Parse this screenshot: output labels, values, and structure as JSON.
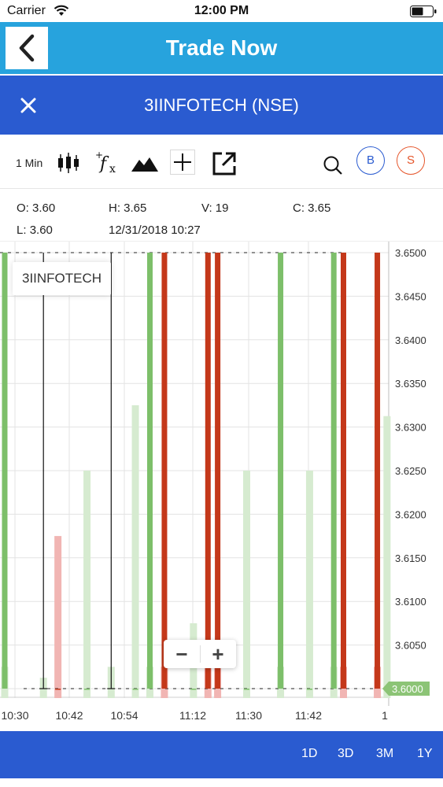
{
  "status_bar": {
    "carrier": "Carrier",
    "time": "12:00 PM"
  },
  "header": {
    "title": "Trade Now"
  },
  "symbol_bar": {
    "title": "3IINFOTECH (NSE)"
  },
  "toolbar": {
    "interval": "1 Min",
    "buy_label": "B",
    "sell_label": "S"
  },
  "ohlc": {
    "open_label": "O:",
    "open": "3.60",
    "high_label": "H:",
    "high": "3.65",
    "volume_label": "V:",
    "volume": "19",
    "close_label": "C:",
    "close": "3.65",
    "low_label": "L:",
    "low": "3.60",
    "datetime": "12/31/2018 10:27"
  },
  "chart": {
    "legend": "3IINFOTECH",
    "current_price": "3.6000"
  },
  "zoom": {
    "minus": "−",
    "plus": "+"
  },
  "range_tabs": [
    "1D",
    "3D",
    "3M",
    "1Y"
  ],
  "colors": {
    "up": "#7dbf6a",
    "down": "#c4381a",
    "up_volume": "#d6ebd0",
    "down_volume": "#f1b5b3",
    "grid": "#e3e3e3",
    "axis_text": "#333333",
    "price_badge": "#8cc476"
  },
  "chart_data": {
    "type": "candlestick",
    "title": "",
    "y_ticks": [
      "3.6500",
      "3.6450",
      "3.6400",
      "3.6350",
      "3.6300",
      "3.6250",
      "3.6200",
      "3.6150",
      "3.6100",
      "3.6050",
      "3.6000"
    ],
    "ylim": [
      3.6,
      3.65
    ],
    "x_ticks": [
      "10:30",
      "10:42",
      "10:54",
      "11:12",
      "11:30",
      "11:42",
      "1"
    ],
    "bars": [
      {
        "idx": 0,
        "dir": "up",
        "open": 3.6,
        "close": 3.65,
        "vol": 0.01
      },
      {
        "idx": 8,
        "dir": "flat",
        "open": 3.6,
        "close": 3.6,
        "high": 3.65,
        "low": 3.6,
        "vol": 0.005
      },
      {
        "idx": 11,
        "dir": "down",
        "open": 3.6,
        "close": 3.6,
        "vol": 0.07
      },
      {
        "idx": 17,
        "dir": "up",
        "open": 3.6,
        "close": 3.6,
        "vol": 0.1
      },
      {
        "idx": 22,
        "dir": "flat",
        "open": 3.6,
        "close": 3.6,
        "high": 3.65,
        "low": 3.6,
        "vol": 0.01
      },
      {
        "idx": 27,
        "dir": "up",
        "open": 3.6,
        "close": 3.6,
        "vol": 0.13
      },
      {
        "idx": 30,
        "dir": "up",
        "open": 3.6,
        "close": 3.65,
        "vol": 0.01
      },
      {
        "idx": 33,
        "dir": "down",
        "open": 3.65,
        "close": 3.6,
        "vol": 0.01
      },
      {
        "idx": 39,
        "dir": "up",
        "open": 3.6,
        "close": 3.6,
        "vol": 0.03
      },
      {
        "idx": 42,
        "dir": "down",
        "open": 3.65,
        "close": 3.6,
        "vol": 0.015
      },
      {
        "idx": 44,
        "dir": "down",
        "open": 3.65,
        "close": 3.6,
        "vol": 0.01
      },
      {
        "idx": 50,
        "dir": "up",
        "open": 3.6,
        "close": 3.6,
        "vol": 0.1
      },
      {
        "idx": 57,
        "dir": "up",
        "open": 3.6,
        "close": 3.65,
        "vol": 0.01
      },
      {
        "idx": 63,
        "dir": "up",
        "open": 3.6,
        "close": 3.6,
        "vol": 0.1
      },
      {
        "idx": 68,
        "dir": "up",
        "open": 3.6,
        "close": 3.65,
        "vol": 0.01
      },
      {
        "idx": 70,
        "dir": "down",
        "open": 3.65,
        "close": 3.6,
        "vol": 0.01
      },
      {
        "idx": 77,
        "dir": "down",
        "open": 3.65,
        "close": 3.6,
        "vol": 0.01
      },
      {
        "idx": 79,
        "dir": "up",
        "open": 3.6,
        "close": 3.6,
        "vol": 0.125
      }
    ]
  }
}
